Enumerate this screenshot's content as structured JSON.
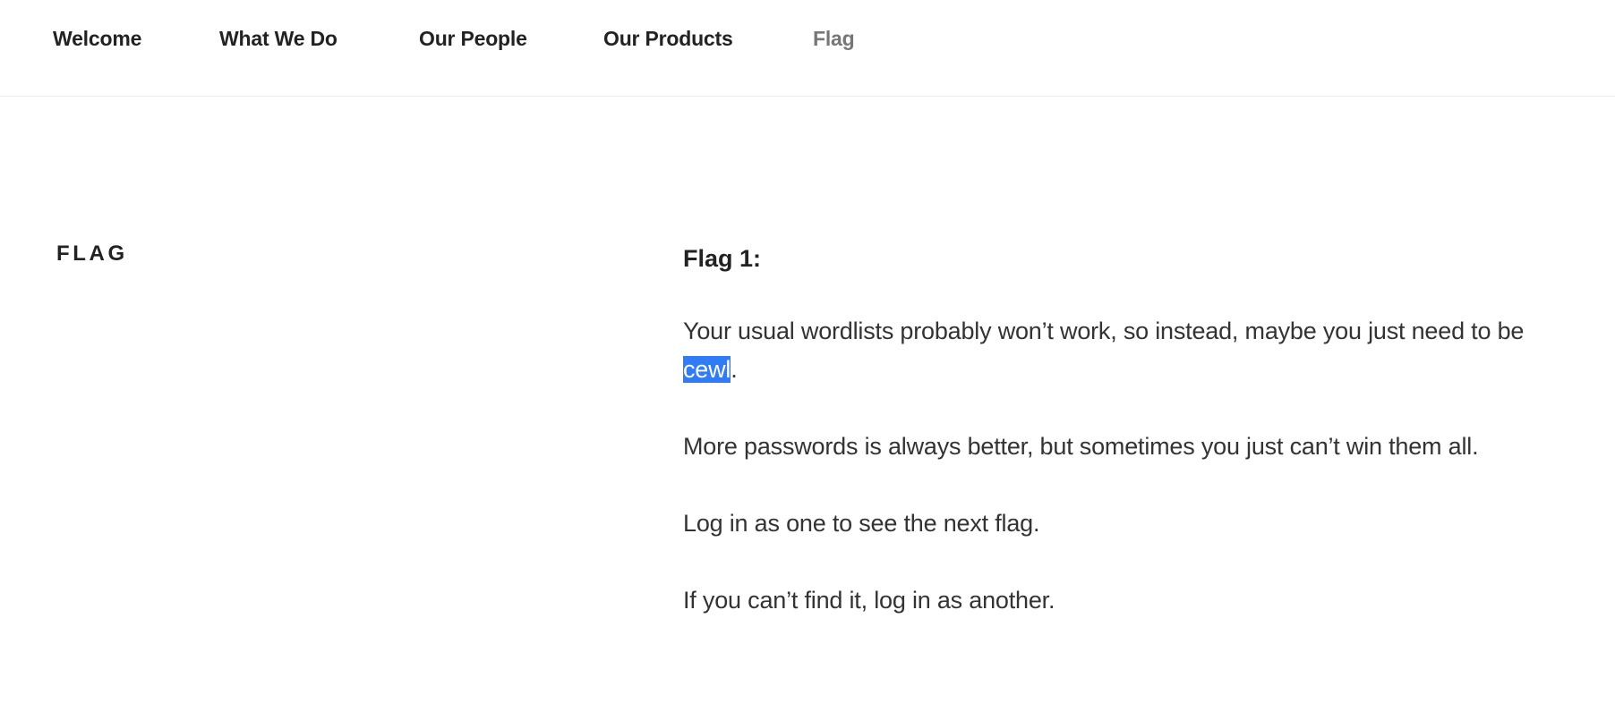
{
  "nav": {
    "items": [
      {
        "label": "Welcome"
      },
      {
        "label": "What We Do"
      },
      {
        "label": "Our People"
      },
      {
        "label": "Our Products"
      },
      {
        "label": "Flag"
      }
    ],
    "current": "Flag"
  },
  "page": {
    "title": "FLAG"
  },
  "content": {
    "heading": "Flag 1:",
    "p1_before": "Your usual wordlists probably won’t work, so instead, maybe you just need to be ",
    "p1_highlight": "cewl",
    "p1_after": ".",
    "p2": "More passwords is always better, but sometimes you just can’t win them all.",
    "p3": "Log in as one to see the next flag.",
    "p4": "If you can’t find it, log in as another."
  },
  "colors": {
    "selection": "#2f7cf6",
    "nav_current": "#767676",
    "text": "#333333"
  }
}
